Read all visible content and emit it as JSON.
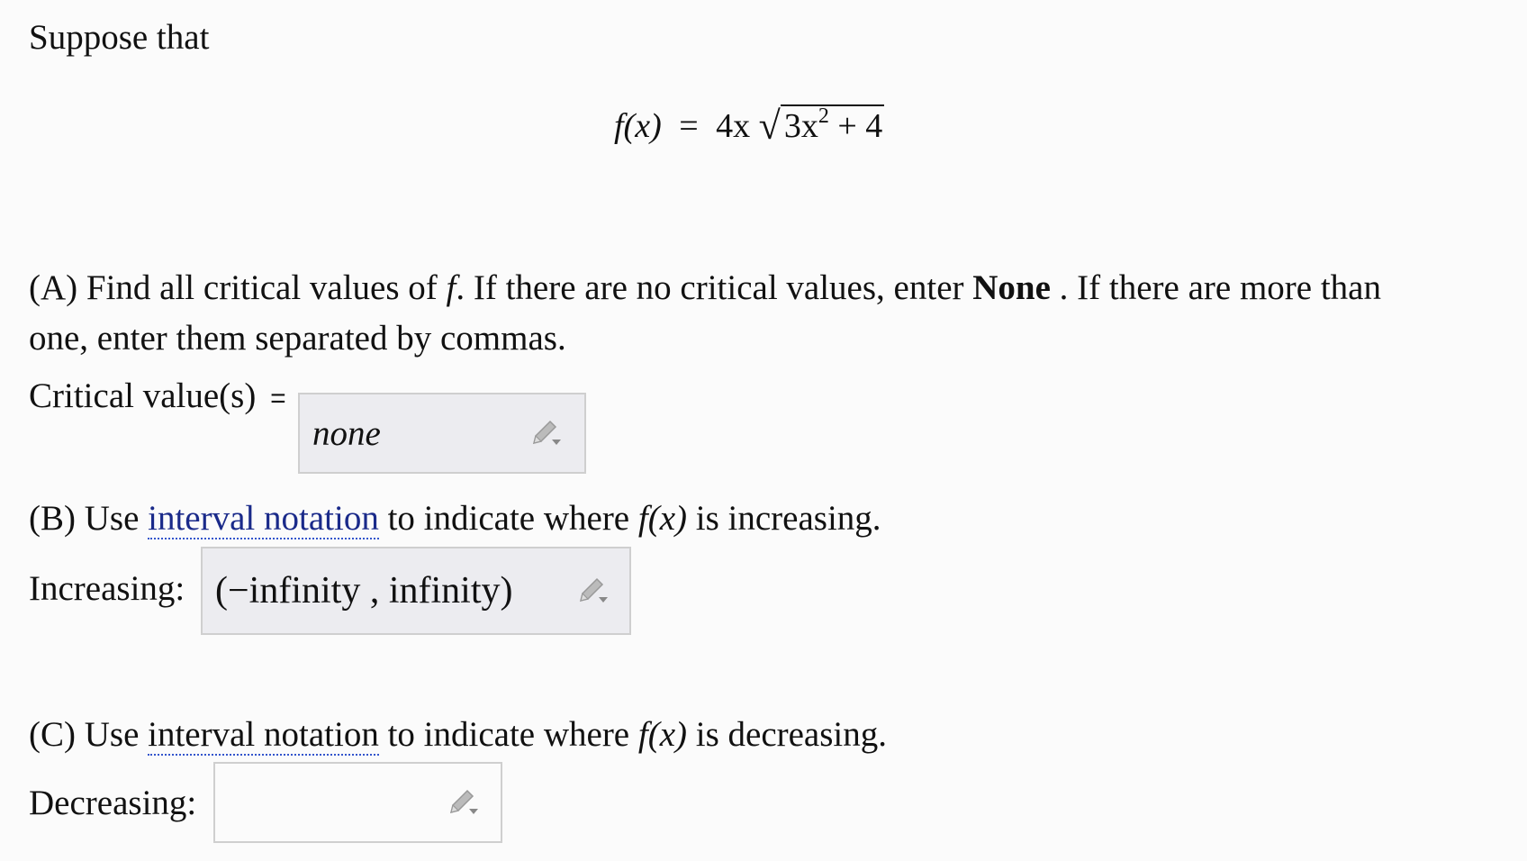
{
  "intro": "Suppose that",
  "formula": {
    "lhs": "f(x)",
    "eq": "=",
    "coef": "4x",
    "radicand_base": "3x",
    "radicand_exp": "2",
    "radicand_rest": "+ 4"
  },
  "partA": {
    "prefix": "(A) Find all critical values of ",
    "f": "f",
    "middle": ". If there are no critical values, enter ",
    "none_word": "None",
    "suffix": " . If there are more than",
    "line2": "one, enter them separated by commas.",
    "label": "Critical value(s)",
    "equals": "=",
    "value": "none"
  },
  "partB": {
    "prefix": "(B) Use ",
    "link": "interval notation",
    "middle": " to indicate where ",
    "fx": "f(x)",
    "suffix": " is increasing.",
    "label": "Increasing:",
    "value": "(−infinity , infinity)"
  },
  "partC": {
    "prefix": "(C) Use ",
    "link": "interval notation",
    "middle": " to indicate where ",
    "fx": "f(x)",
    "suffix": " is decreasing.",
    "label": "Decreasing:",
    "value": ""
  },
  "icons": {
    "edit": "pencil-icon"
  }
}
